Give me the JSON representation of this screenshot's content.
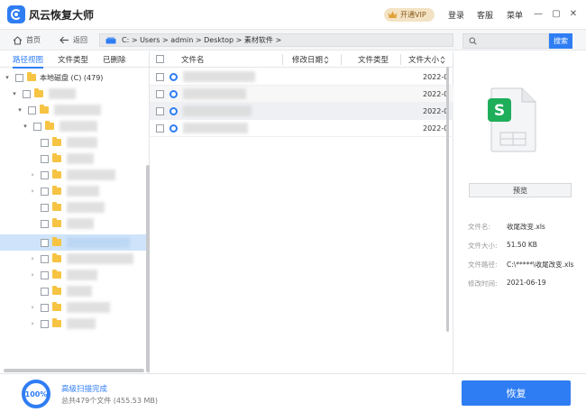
{
  "app": {
    "title": "风云恢复大师"
  },
  "header": {
    "vip_label": "开通VIP",
    "login": "登录",
    "support": "客服",
    "menu": "菜单",
    "minimize": "—",
    "maximize": "▢",
    "close": "✕"
  },
  "nav": {
    "home": "首页",
    "back": "返回",
    "path": "C: > Users > admin > Desktop > 素材软件 >",
    "search_placeholder": "",
    "search_button": "搜索"
  },
  "left_tabs": [
    "路径视图",
    "文件类型",
    "已删除"
  ],
  "tree": {
    "root_label": "本地磁盘 (C) (479)"
  },
  "list": {
    "columns": [
      "文件名",
      "修改日期",
      "文件类型",
      "文件大小"
    ],
    "rows": [
      {
        "date": "2022-0"
      },
      {
        "date": "2022-0"
      },
      {
        "date": "2022-0"
      },
      {
        "date": "2022-0"
      }
    ]
  },
  "preview": {
    "button": "预览",
    "labels": [
      "文件名:",
      "文件大小:",
      "文件路径:",
      "修改时间:"
    ],
    "values": [
      "收尾改变.xls",
      "51.50 KB",
      "C:\\*****\\收尾改变.xls",
      "2021-06-19"
    ]
  },
  "bottom": {
    "progress": "100%",
    "status": "高级扫描完成",
    "summary": "总共479个文件 (455.53 MB)",
    "recover": "恢复"
  },
  "colors": {
    "accent": "#2f7df3",
    "vip_bg": "#f3e3c4"
  }
}
